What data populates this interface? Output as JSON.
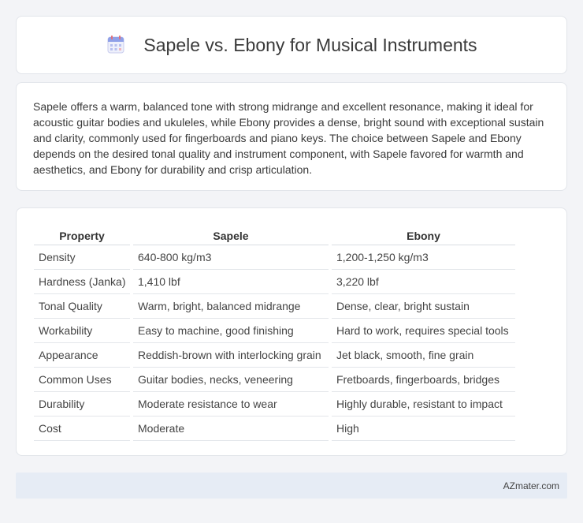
{
  "header": {
    "title": "Sapele vs. Ebony for Musical Instruments",
    "icon": "calendar-icon"
  },
  "summary": {
    "text": "Sapele offers a warm, balanced tone with strong midrange and excellent resonance, making it ideal for acoustic guitar bodies and ukuleles, while Ebony provides a dense, bright sound with exceptional sustain and clarity, commonly used for fingerboards and piano keys. The choice between Sapele and Ebony depends on the desired tonal quality and instrument component, with Sapele favored for warmth and aesthetics, and Ebony for durability and crisp articulation."
  },
  "table": {
    "headers": [
      "Property",
      "Sapele",
      "Ebony"
    ],
    "rows": [
      [
        "Density",
        "640-800 kg/m3",
        "1,200-1,250 kg/m3"
      ],
      [
        "Hardness (Janka)",
        "1,410 lbf",
        "3,220 lbf"
      ],
      [
        "Tonal Quality",
        "Warm, bright, balanced midrange",
        "Dense, clear, bright sustain"
      ],
      [
        "Workability",
        "Easy to machine, good finishing",
        "Hard to work, requires special tools"
      ],
      [
        "Appearance",
        "Reddish-brown with interlocking grain",
        "Jet black, smooth, fine grain"
      ],
      [
        "Common Uses",
        "Guitar bodies, necks, veneering",
        "Fretboards, fingerboards, bridges"
      ],
      [
        "Durability",
        "Moderate resistance to wear",
        "Highly durable, resistant to impact"
      ],
      [
        "Cost",
        "Moderate",
        "High"
      ]
    ]
  },
  "footer": {
    "text": "AZmater.com"
  }
}
